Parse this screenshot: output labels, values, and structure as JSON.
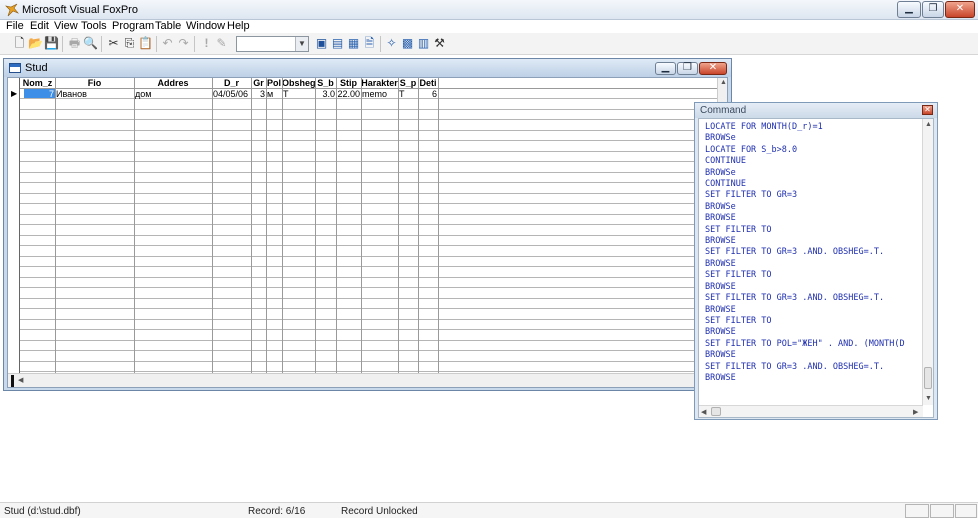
{
  "app": {
    "title": "Microsoft Visual FoxPro"
  },
  "menu": [
    "File",
    "Edit",
    "View",
    "Tools",
    "Program",
    "Table",
    "Window",
    "Help"
  ],
  "toolbar": {
    "icons": [
      "new-file-icon",
      "open-folder-icon",
      "save-icon",
      "print-icon",
      "print-preview-icon",
      "cut-icon",
      "copy-icon",
      "paste-icon",
      "undo-icon",
      "redo-icon",
      "run-icon",
      "modify-form-icon",
      "database-icon",
      "command-window-icon",
      "properties-icon",
      "form-wizard-icon",
      "report-icon",
      "data-session-icon",
      "code-icon",
      "tools-icon"
    ],
    "combo_value": ""
  },
  "browse": {
    "title": "Stud",
    "columns": [
      "Nom_z",
      "Fio",
      "Addres",
      "D_r",
      "Gr",
      "Pol",
      "Obsheg",
      "S_b",
      "Stip",
      "Harakter",
      "S_p",
      "Deti"
    ],
    "rows": [
      [
        "7",
        "Иванов",
        "дом",
        "04/05/06",
        "3",
        "м",
        "T",
        "3.0",
        "22.00",
        "memo",
        "T",
        "6"
      ]
    ]
  },
  "command": {
    "title": "Command",
    "lines": [
      "LOCATE FOR MONTH(D_r)=1",
      "BROWSe",
      "LOCATE FOR S_b>8.0",
      "CONTINUE",
      "BROWSe",
      "CONTINUE",
      "SET FILTER TO GR=3",
      "BROWSe",
      "BROWSE",
      "SET FILTER TO",
      "BROWSE",
      "SET FILTER TO GR=3 .AND. OBSHEG=.T.",
      "BROWSE",
      "SET FILTER TO",
      "BROWSE",
      "SET FILTER TO GR=3 .AND. OBSHEG=.T.",
      "BROWSE",
      "SET FILTER TO",
      "BROWSE",
      "SET FILTER TO POL=\"ЖЕН\" . AND. (MONTH(D",
      "BROWSE",
      "SET FILTER TO GR=3 .AND. OBSHEG=.T.",
      "BROWSE"
    ]
  },
  "status": {
    "table": "Stud (d:\\stud.dbf)",
    "record": "Record: 6/16",
    "lock": "Record Unlocked"
  }
}
